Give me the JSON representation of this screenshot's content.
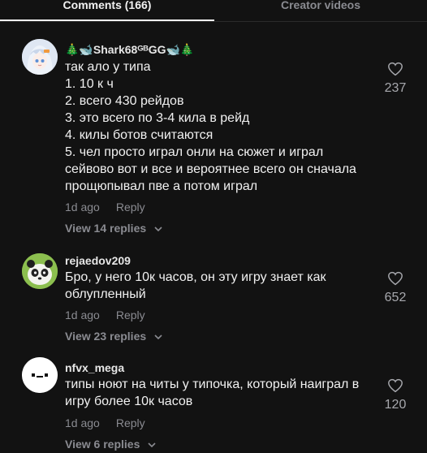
{
  "tabs": {
    "comments": "Comments (166)",
    "creator_videos": "Creator videos"
  },
  "comments": [
    {
      "username": "🎄🐋Shark68ᴳᴮGG🐋🎄",
      "text": "так ало у типа\n1. 10 к ч\n2. всего 430 рейдов\n3. это всего по 3-4 кила в рейд\n4. килы ботов считаются\n5. чел просто играл онли на сюжет и играл сейвово вот и все и вероятнее всего он сначала прощюпывал пве а потом играл",
      "time": "1d ago",
      "reply": "Reply",
      "view_replies": "View 14 replies",
      "likes": "237"
    },
    {
      "username": "rejaedov209",
      "text": "Бро, у него 10к часов, он эту игру знает как облупленный",
      "time": "1d ago",
      "reply": "Reply",
      "view_replies": "View 23 replies",
      "likes": "652"
    },
    {
      "username": "nfvx_mega",
      "text": "типы ноют на читы у типочка, который наиграл в игру более 10к часов",
      "time": "1d ago",
      "reply": "Reply",
      "view_replies": "View 6 replies",
      "likes": "120"
    }
  ],
  "icons": {
    "like": "heart-icon",
    "expand": "chevron-down-icon"
  }
}
